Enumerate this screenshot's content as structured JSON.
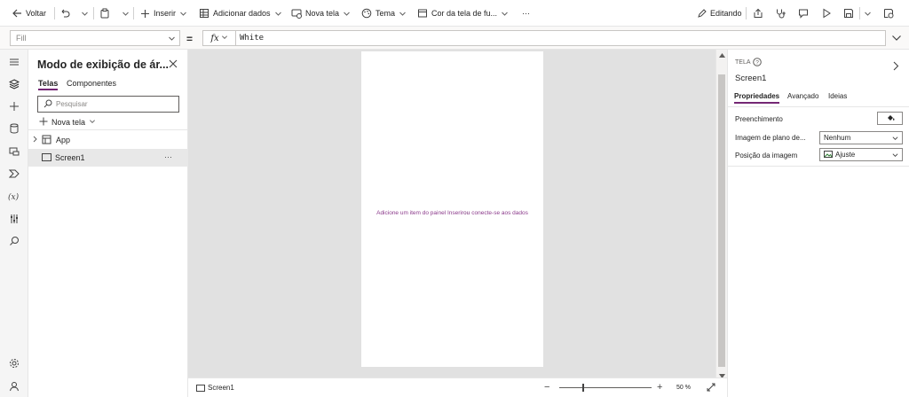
{
  "toolbar": {
    "back_label": "Voltar",
    "insert_label": "Inserir",
    "add_data_label": "Adicionar dados",
    "new_screen_label": "Nova tela",
    "theme_label": "Tema",
    "fill_label": "Cor da tela de fu...",
    "more_label": "···",
    "editing_label": "Editando"
  },
  "formula_bar": {
    "property": "Fill",
    "equals": "=",
    "fx_label": "fx",
    "formula": "White"
  },
  "tree_view": {
    "title": "Modo de exibição de ár...",
    "tabs": [
      "Telas",
      "Componentes"
    ],
    "search_placeholder": "Pesquisar",
    "new_screen_label": "Nova tela",
    "items": [
      {
        "label": "App"
      },
      {
        "label": "Screen1",
        "more": "···"
      }
    ]
  },
  "canvas": {
    "hint_part1": "Adicione um item do painel Inserir",
    "hint_part2": "ou",
    "hint_part3": "conecte-se aos dados"
  },
  "status_bar": {
    "screen_name": "Screen1",
    "zoom_minus": "−",
    "zoom_plus": "+",
    "zoom_value": "50",
    "zoom_unit": "%",
    "zoom_fraction": 0.5
  },
  "properties_panel": {
    "kind": "TELA",
    "name": "Screen1",
    "tabs": [
      "Propriedades",
      "Avançado",
      "Ideias"
    ],
    "rows": [
      {
        "label": "Preenchimento"
      },
      {
        "label": "Imagem de plano de...",
        "value": "Nenhum"
      },
      {
        "label": "Posição da imagem",
        "value": "Ajuste"
      }
    ]
  },
  "colors": {
    "accent": "#742774",
    "canvas_bg": "#e1e1e1",
    "hint": "#8b3a8b"
  }
}
